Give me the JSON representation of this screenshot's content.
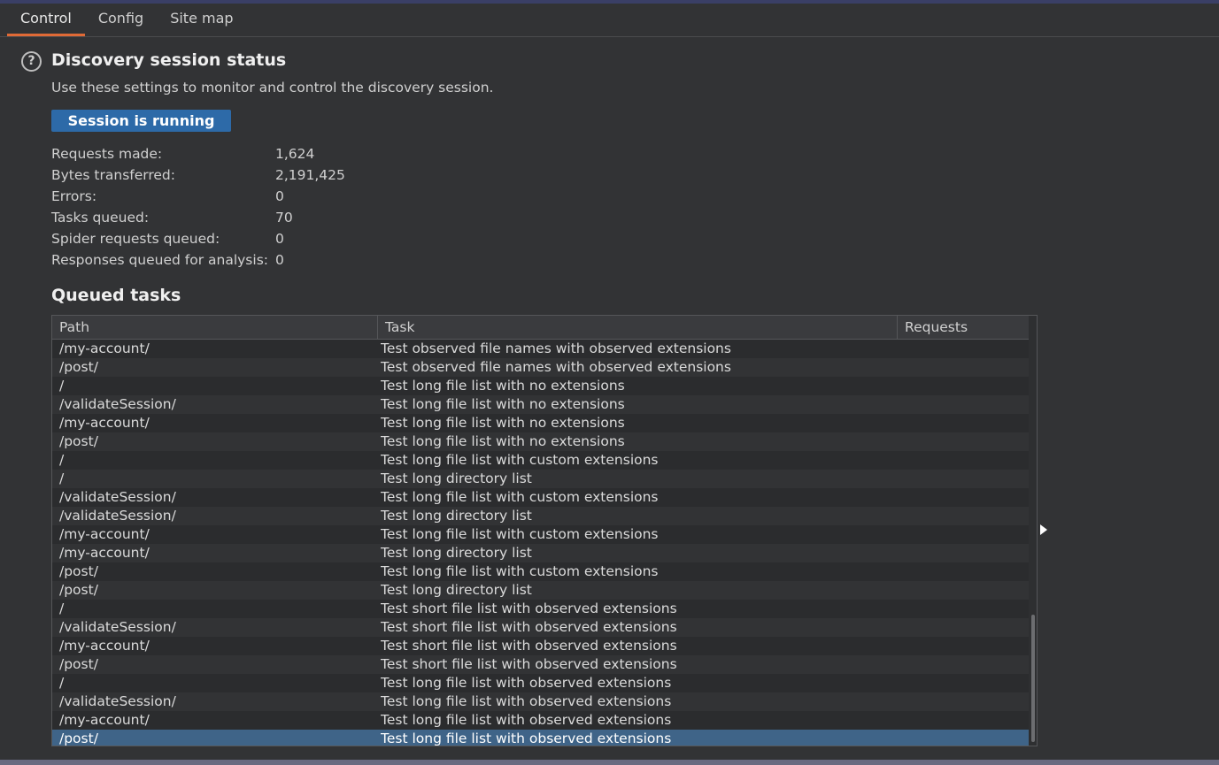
{
  "tabs": [
    {
      "label": "Control",
      "active": true
    },
    {
      "label": "Config",
      "active": false
    },
    {
      "label": "Site map",
      "active": false
    }
  ],
  "help_icon_glyph": "?",
  "status_section": {
    "title": "Discovery session status",
    "description": "Use these settings to monitor and control the discovery session.",
    "button_label": "Session is running",
    "button_color": "#2d6aa8"
  },
  "stats": [
    {
      "label": "Requests made:",
      "value": "1,624"
    },
    {
      "label": "Bytes transferred:",
      "value": "2,191,425"
    },
    {
      "label": "Errors:",
      "value": "0"
    },
    {
      "label": "Tasks queued:",
      "value": "70"
    },
    {
      "label": "Spider requests queued:",
      "value": "0"
    },
    {
      "label": "Responses queued for analysis:",
      "value": "0"
    }
  ],
  "queued_tasks": {
    "title": "Queued tasks",
    "columns": [
      "Path",
      "Task",
      "Requests"
    ],
    "rows": [
      {
        "path": "/my-account/",
        "task": "Test observed file names with observed extensions",
        "requests": ""
      },
      {
        "path": "/post/",
        "task": "Test observed file names with observed extensions",
        "requests": ""
      },
      {
        "path": "/",
        "task": "Test long file list with no extensions",
        "requests": ""
      },
      {
        "path": "/validateSession/",
        "task": "Test long file list with no extensions",
        "requests": ""
      },
      {
        "path": "/my-account/",
        "task": "Test long file list with no extensions",
        "requests": ""
      },
      {
        "path": "/post/",
        "task": "Test long file list with no extensions",
        "requests": ""
      },
      {
        "path": "/",
        "task": "Test long file list with custom extensions",
        "requests": ""
      },
      {
        "path": "/",
        "task": "Test long directory list",
        "requests": ""
      },
      {
        "path": "/validateSession/",
        "task": "Test long file list with custom extensions",
        "requests": ""
      },
      {
        "path": "/validateSession/",
        "task": "Test long directory list",
        "requests": ""
      },
      {
        "path": "/my-account/",
        "task": "Test long file list with custom extensions",
        "requests": ""
      },
      {
        "path": "/my-account/",
        "task": "Test long directory list",
        "requests": ""
      },
      {
        "path": "/post/",
        "task": "Test long file list with custom extensions",
        "requests": ""
      },
      {
        "path": "/post/",
        "task": "Test long directory list",
        "requests": ""
      },
      {
        "path": "/",
        "task": "Test short file list with observed extensions",
        "requests": ""
      },
      {
        "path": "/validateSession/",
        "task": "Test short file list with observed extensions",
        "requests": ""
      },
      {
        "path": "/my-account/",
        "task": "Test short file list with observed extensions",
        "requests": ""
      },
      {
        "path": "/post/",
        "task": "Test short file list with observed extensions",
        "requests": ""
      },
      {
        "path": "/",
        "task": "Test long file list with observed extensions",
        "requests": ""
      },
      {
        "path": "/validateSession/",
        "task": "Test long file list with observed extensions",
        "requests": ""
      },
      {
        "path": "/my-account/",
        "task": "Test long file list with observed extensions",
        "requests": ""
      },
      {
        "path": "/post/",
        "task": "Test long file list with observed extensions",
        "requests": "",
        "selected": true
      }
    ]
  },
  "colors": {
    "accent_tab": "#e06a36",
    "selection": "#3f6488",
    "panel_bg": "#323335"
  }
}
